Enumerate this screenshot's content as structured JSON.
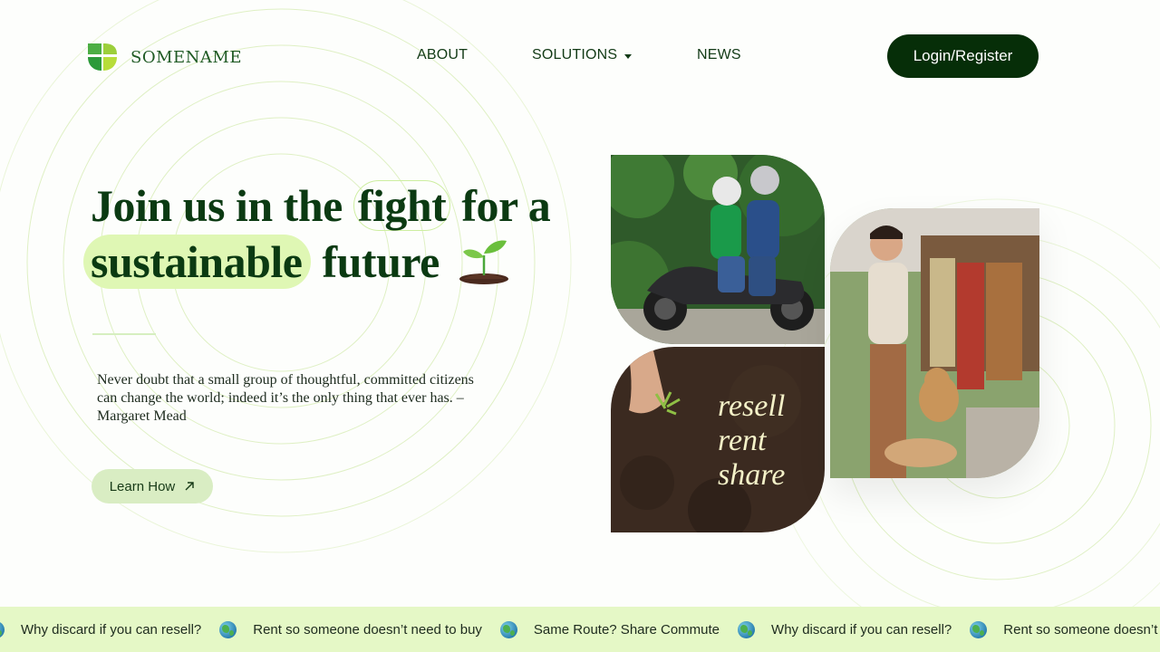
{
  "brand": {
    "name": "SOMENAME"
  },
  "nav": {
    "items": [
      {
        "label": "ABOUT"
      },
      {
        "label": "SOLUTIONS"
      },
      {
        "label": "NEWS"
      }
    ],
    "login_label": "Login/Register"
  },
  "hero": {
    "title_part1": "Join us in the",
    "title_highlight1": "fight",
    "title_part2": "for a",
    "title_highlight2": "sustainable",
    "title_part3": "future",
    "quote": "Never doubt that a small group of thoughtful, committed citizens can change the world; indeed it’s the only thing that ever has. – Margaret Mead",
    "cta_label": "Learn How"
  },
  "images": {
    "tagline": [
      "resell",
      "rent",
      "share"
    ]
  },
  "ticker": {
    "items": [
      "Why discard if you can resell?",
      "Rent so someone doesn’t need to buy",
      "Same Route? Share Commute",
      "Why discard if you can resell?",
      "Rent so someone doesn’t need to buy"
    ]
  },
  "colors": {
    "primary_dark": "#062e08",
    "accent_light": "#dff7b4",
    "ticker_bg": "#e5f8c6",
    "button_light": "#d9edc3"
  }
}
